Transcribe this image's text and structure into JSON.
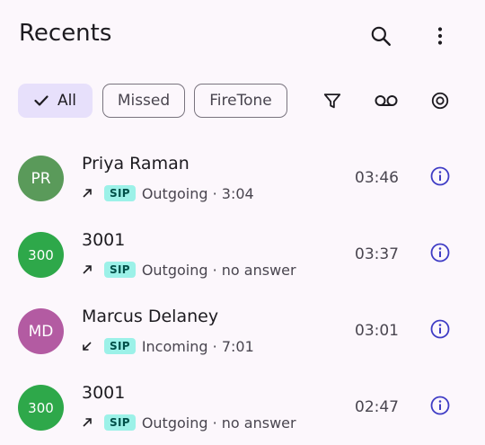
{
  "header": {
    "title": "Recents",
    "search_icon": "search-icon",
    "menu_icon": "more-vert-icon"
  },
  "filters": {
    "chips": [
      {
        "label": "All",
        "selected": true
      },
      {
        "label": "Missed",
        "selected": false
      },
      {
        "label": "FireTone",
        "selected": false
      }
    ],
    "actions": [
      "filter-icon",
      "voicemail-icon",
      "record-icon"
    ]
  },
  "colors": {
    "background": "#fcf7fc",
    "chip_selected": "#e7e0fb",
    "badge_bg": "#9cf1e8",
    "info_icon": "#3f3cc5",
    "avatar_green": "#5a9a5a",
    "avatar_bright_green": "#2ea84a",
    "avatar_purple": "#b35ba2"
  },
  "calls": [
    {
      "initials": "PR",
      "name": "Priya Raman",
      "direction": "outgoing",
      "badge": "SIP",
      "detail": "Outgoing · 3:04",
      "time": "03:46",
      "avatar_color": "#5a9a5a"
    },
    {
      "initials": "300",
      "name": "3001",
      "direction": "outgoing",
      "badge": "SIP",
      "detail": "Outgoing · no answer",
      "time": "03:37",
      "avatar_color": "#2ea84a"
    },
    {
      "initials": "MD",
      "name": "Marcus Delaney",
      "direction": "incoming",
      "badge": "SIP",
      "detail": "Incoming · 7:01",
      "time": "03:01",
      "avatar_color": "#b35ba2"
    },
    {
      "initials": "300",
      "name": "3001",
      "direction": "outgoing",
      "badge": "SIP",
      "detail": "Outgoing · no answer",
      "time": "02:47",
      "avatar_color": "#2ea84a"
    }
  ]
}
